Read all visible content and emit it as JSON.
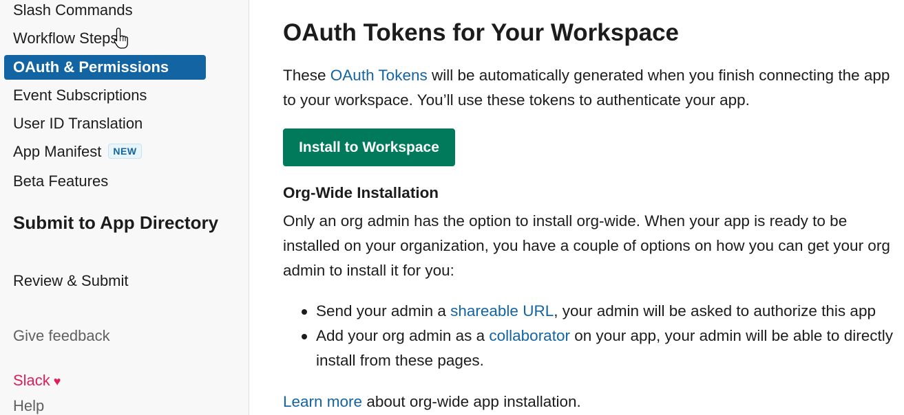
{
  "sidebar": {
    "items": [
      {
        "label": "Slash Commands"
      },
      {
        "label": "Workflow Steps"
      },
      {
        "label": "OAuth & Permissions",
        "active": true
      },
      {
        "label": "Event Subscriptions"
      },
      {
        "label": "User ID Translation"
      },
      {
        "label": "App Manifest",
        "badge": "NEW"
      },
      {
        "label": "Beta Features"
      }
    ],
    "section_heading": "Submit to App Directory",
    "section_items": [
      {
        "label": "Review & Submit"
      }
    ],
    "give_feedback": "Give feedback",
    "brand": "Slack",
    "help": "Help"
  },
  "main": {
    "title": "OAuth Tokens for Your Workspace",
    "intro": {
      "before": "These ",
      "link": "OAuth Tokens",
      "after": " will be automatically generated when you finish connecting the app to your workspace. You’ll use these tokens to authenticate your app."
    },
    "install_button": "Install to Workspace",
    "org_heading": "Org-Wide Installation",
    "org_text": "Only an org admin has the option to install org-wide. When your app is ready to be installed on your organization, you have a couple of options on how you can get your org admin to install it for you:",
    "bullets": [
      {
        "before": "Send your admin a ",
        "link": "shareable URL",
        "after": ", your admin will be asked to authorize this app"
      },
      {
        "before": "Add your org admin as a ",
        "link": "collaborator",
        "after": " on your app, your admin will be able to directly install from these pages."
      }
    ],
    "learn_more": {
      "link": "Learn more",
      "after": " about org-wide app installation."
    }
  },
  "colors": {
    "active_nav": "#1264a3",
    "link": "#1264a3",
    "install_button": "#007a5a",
    "brand": "#e01e5a"
  },
  "icons": {
    "heart": "heart-icon",
    "cursor": "hand-pointer-cursor"
  }
}
